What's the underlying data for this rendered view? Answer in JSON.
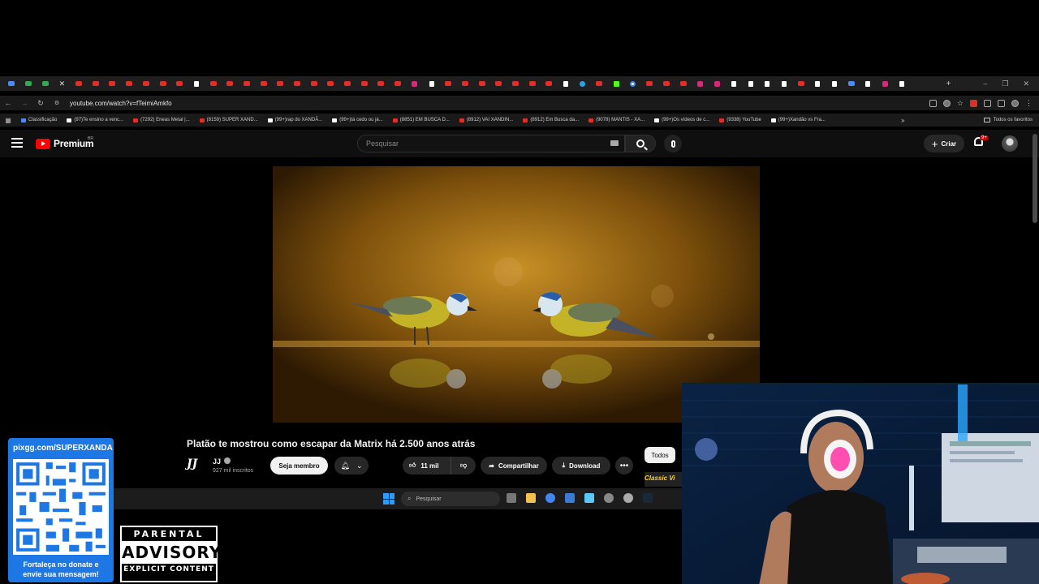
{
  "browser": {
    "tabs": [
      "blue",
      "green",
      "green",
      "close",
      "yt",
      "yt",
      "yt",
      "yt",
      "yt",
      "yt",
      "yt",
      "tiktok",
      "yt",
      "yt",
      "yt",
      "yt",
      "yt",
      "yt",
      "yt",
      "yt",
      "yt",
      "yt",
      "yt",
      "yt",
      "ig",
      "tiktok",
      "yt",
      "yt",
      "yt",
      "yt",
      "yt",
      "yt",
      "yt",
      "tiktok",
      "tg",
      "yt",
      "kick",
      "google",
      "yt",
      "yt",
      "yt",
      "ig",
      "ig",
      "tiktok",
      "tiktok",
      "tiktok",
      "tiktok",
      "yt",
      "tiktok",
      "tiktok",
      "blue",
      "tiktok",
      "ig",
      "tiktok"
    ],
    "new_tab_label": "+",
    "window_controls": [
      "–",
      "❐",
      "✕"
    ],
    "url": "youtube.com/watch?v=fTeimiAmkfo",
    "bookmarks": [
      {
        "label": "Classificação",
        "icon": "cl"
      },
      {
        "label": "(97)Te ensino a venc...",
        "icon": "tk"
      },
      {
        "label": "(7292) Eneas Metal |...",
        "icon": "yt"
      },
      {
        "label": "(8159) SUPER XAND...",
        "icon": "yt"
      },
      {
        "label": "(99+)rap do XANDÃ...",
        "icon": "tk"
      },
      {
        "label": "(99+)tá cedo ou já...",
        "icon": "tk"
      },
      {
        "label": "(8851) EM BUSCA D...",
        "icon": "yt"
      },
      {
        "label": "(8912) VAI XANDIN...",
        "icon": "yt"
      },
      {
        "label": "(8912) Em Busca da...",
        "icon": "yt"
      },
      {
        "label": "(9078) MANTIS - XA...",
        "icon": "yt"
      },
      {
        "label": "(99+)Os vídeos de c...",
        "icon": "tk"
      },
      {
        "label": "(9338) YouTube",
        "icon": "yt"
      },
      {
        "label": "(99+)Xandão vs Fra...",
        "icon": "tk"
      }
    ],
    "bookmarks_more": "»",
    "all_bookmarks": "Todos os favoritos"
  },
  "youtube": {
    "brand": "Premium",
    "country": "BR",
    "search_placeholder": "Pesquisar",
    "create_label": "Criar",
    "notifications_badge": "9+",
    "video": {
      "title": "Platão te mostrou como escapar da Matrix há 2.500 anos atrás",
      "channel_logo": "JJ",
      "channel_name": "JJ",
      "subscribers": "927 mil inscritos",
      "join_label": "Seja membro",
      "likes": "11 mil",
      "share_label": "Compartilhar",
      "download_label": "Download",
      "more_label": "•••"
    },
    "chip_label": "Todos",
    "related_thumb_text": "Classic Vi"
  },
  "taskbar": {
    "search_placeholder": "Pesquisar"
  },
  "overlay": {
    "donate_url": "pixgg.com/SUPERXANDA",
    "donate_message_line1": "Fortaleça no donate e",
    "donate_message_line2": "envie sua mensagem!",
    "advisory_top": "PARENTAL",
    "advisory_mid": "ADVISORY",
    "advisory_bot": "EXPLICIT CONTENT"
  },
  "colors": {
    "youtube_red": "#ff0000",
    "donate_blue": "#1d78e6",
    "page_bg": "#0f0f0f"
  }
}
